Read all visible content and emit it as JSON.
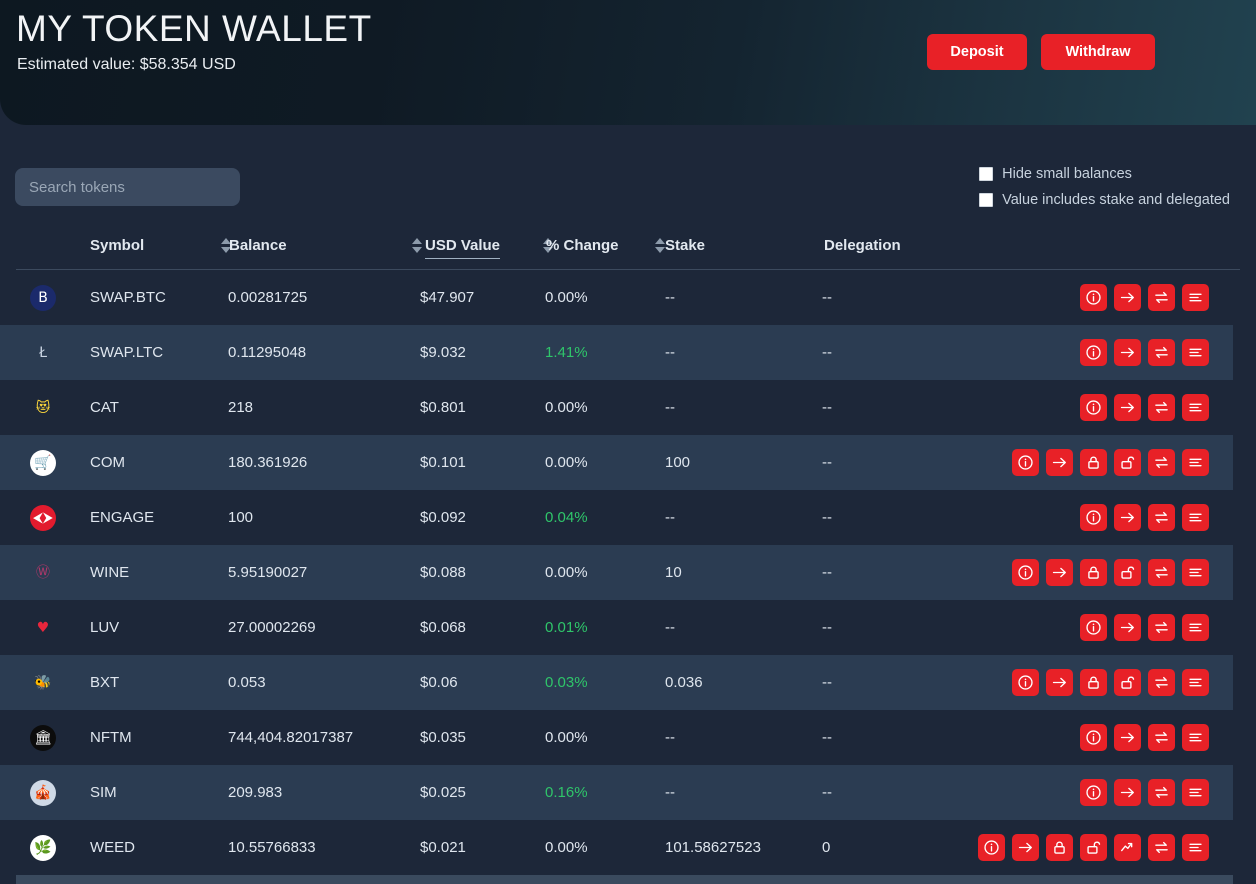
{
  "header": {
    "title": "MY TOKEN WALLET",
    "estimated_value": "Estimated value: $58.354 USD",
    "deposit_label": "Deposit",
    "withdraw_label": "Withdraw",
    "accent_color": "#e82127",
    "background_gradient": [
      "#0d1821",
      "#21424f"
    ]
  },
  "controls": {
    "search_placeholder": "Search tokens",
    "search_value": "",
    "checkboxes": [
      {
        "label": "Hide small balances",
        "checked": false
      },
      {
        "label": "Value includes stake and delegated",
        "checked": false
      }
    ]
  },
  "table": {
    "columns": [
      {
        "key": "symbol",
        "label": "Symbol",
        "sortable": true,
        "sorted": false
      },
      {
        "key": "balance",
        "label": "Balance",
        "sortable": true,
        "sorted": false
      },
      {
        "key": "usd_value",
        "label": "USD Value",
        "sortable": true,
        "sorted": true
      },
      {
        "key": "pct_change",
        "label": "% Change",
        "sortable": true,
        "sorted": false
      },
      {
        "key": "stake",
        "label": "Stake",
        "sortable": false,
        "sorted": false
      },
      {
        "key": "delegation",
        "label": "Delegation",
        "sortable": false,
        "sorted": false
      }
    ],
    "positive_color": "#2fc56a",
    "rows": [
      {
        "symbol": "SWAP.BTC",
        "balance": "0.00281725",
        "usd_value": "$47.907",
        "pct_change": "0.00%",
        "pct_dir": "flat",
        "stake": "--",
        "delegation": "--",
        "logo": {
          "kind": "letter",
          "text": "B",
          "bg": "#1b2a6b",
          "fg": "#ffffff"
        },
        "actions": [
          "info-icon",
          "send-icon",
          "swap-icon",
          "list-icon"
        ]
      },
      {
        "symbol": "SWAP.LTC",
        "balance": "0.11295048",
        "usd_value": "$9.032",
        "pct_change": "1.41%",
        "pct_dir": "up",
        "stake": "--",
        "delegation": "--",
        "logo": {
          "kind": "letter",
          "text": "Ł",
          "bg": "transparent",
          "fg": "#c9d4e2"
        },
        "actions": [
          "info-icon",
          "send-icon",
          "swap-icon",
          "list-icon"
        ]
      },
      {
        "symbol": "CAT",
        "balance": "218",
        "usd_value": "$0.801",
        "pct_change": "0.00%",
        "pct_dir": "flat",
        "stake": "--",
        "delegation": "--",
        "logo": {
          "kind": "emoji",
          "text": "😻",
          "bg": "transparent",
          "fg": "#ffd93b"
        },
        "actions": [
          "info-icon",
          "send-icon",
          "swap-icon",
          "list-icon"
        ]
      },
      {
        "symbol": "COM",
        "balance": "180.361926",
        "usd_value": "$0.101",
        "pct_change": "0.00%",
        "pct_dir": "flat",
        "stake": "100",
        "delegation": "--",
        "logo": {
          "kind": "emoji",
          "text": "🛒",
          "bg": "#ffffff",
          "fg": "#e02044"
        },
        "actions": [
          "info-icon",
          "send-icon",
          "lock-icon",
          "unlock-icon",
          "swap-icon",
          "list-icon"
        ]
      },
      {
        "symbol": "ENGAGE",
        "balance": "100",
        "usd_value": "$0.092",
        "pct_change": "0.04%",
        "pct_dir": "up",
        "stake": "--",
        "delegation": "--",
        "logo": {
          "kind": "letter",
          "text": "⮜⮞",
          "bg": "#e21b2e",
          "fg": "#ffffff"
        },
        "actions": [
          "info-icon",
          "send-icon",
          "swap-icon",
          "list-icon"
        ]
      },
      {
        "symbol": "WINE",
        "balance": "5.95190027",
        "usd_value": "$0.088",
        "pct_change": "0.00%",
        "pct_dir": "flat",
        "stake": "10",
        "delegation": "--",
        "logo": {
          "kind": "letter",
          "text": "Ⓦ",
          "bg": "transparent",
          "fg": "#b4386b"
        },
        "actions": [
          "info-icon",
          "send-icon",
          "lock-icon",
          "unlock-icon",
          "swap-icon",
          "list-icon"
        ]
      },
      {
        "symbol": "LUV",
        "balance": "27.00002269",
        "usd_value": "$0.068",
        "pct_change": "0.01%",
        "pct_dir": "up",
        "stake": "--",
        "delegation": "--",
        "logo": {
          "kind": "emoji",
          "text": "♥",
          "bg": "transparent",
          "fg": "#e8263c"
        },
        "actions": [
          "info-icon",
          "send-icon",
          "swap-icon",
          "list-icon"
        ]
      },
      {
        "symbol": "BXT",
        "balance": "0.053",
        "usd_value": "$0.06",
        "pct_change": "0.03%",
        "pct_dir": "up",
        "stake": "0.036",
        "delegation": "--",
        "logo": {
          "kind": "emoji",
          "text": "🐝",
          "bg": "transparent",
          "fg": "#e8263c"
        },
        "actions": [
          "info-icon",
          "send-icon",
          "lock-icon",
          "unlock-icon",
          "swap-icon",
          "list-icon"
        ]
      },
      {
        "symbol": "NFTM",
        "balance": "744,404.82017387",
        "usd_value": "$0.035",
        "pct_change": "0.00%",
        "pct_dir": "flat",
        "stake": "--",
        "delegation": "--",
        "logo": {
          "kind": "emoji",
          "text": "🏛",
          "bg": "#0c0c0c",
          "fg": "#ffffff"
        },
        "actions": [
          "info-icon",
          "send-icon",
          "swap-icon",
          "list-icon"
        ]
      },
      {
        "symbol": "SIM",
        "balance": "209.983",
        "usd_value": "$0.025",
        "pct_change": "0.16%",
        "pct_dir": "up",
        "stake": "--",
        "delegation": "--",
        "logo": {
          "kind": "emoji",
          "text": "🎪",
          "bg": "#cfd9e6",
          "fg": "#d8304d"
        },
        "actions": [
          "info-icon",
          "send-icon",
          "swap-icon",
          "list-icon"
        ]
      },
      {
        "symbol": "WEED",
        "balance": "10.55766833",
        "usd_value": "$0.021",
        "pct_change": "0.00%",
        "pct_dir": "flat",
        "stake": "101.58627523",
        "delegation": "0",
        "logo": {
          "kind": "emoji",
          "text": "🌿",
          "bg": "#ffffff",
          "fg": "#2e9b3a"
        },
        "actions": [
          "info-icon",
          "send-icon",
          "lock-icon",
          "unlock-icon",
          "trend-icon",
          "swap-icon",
          "list-icon"
        ]
      }
    ]
  }
}
